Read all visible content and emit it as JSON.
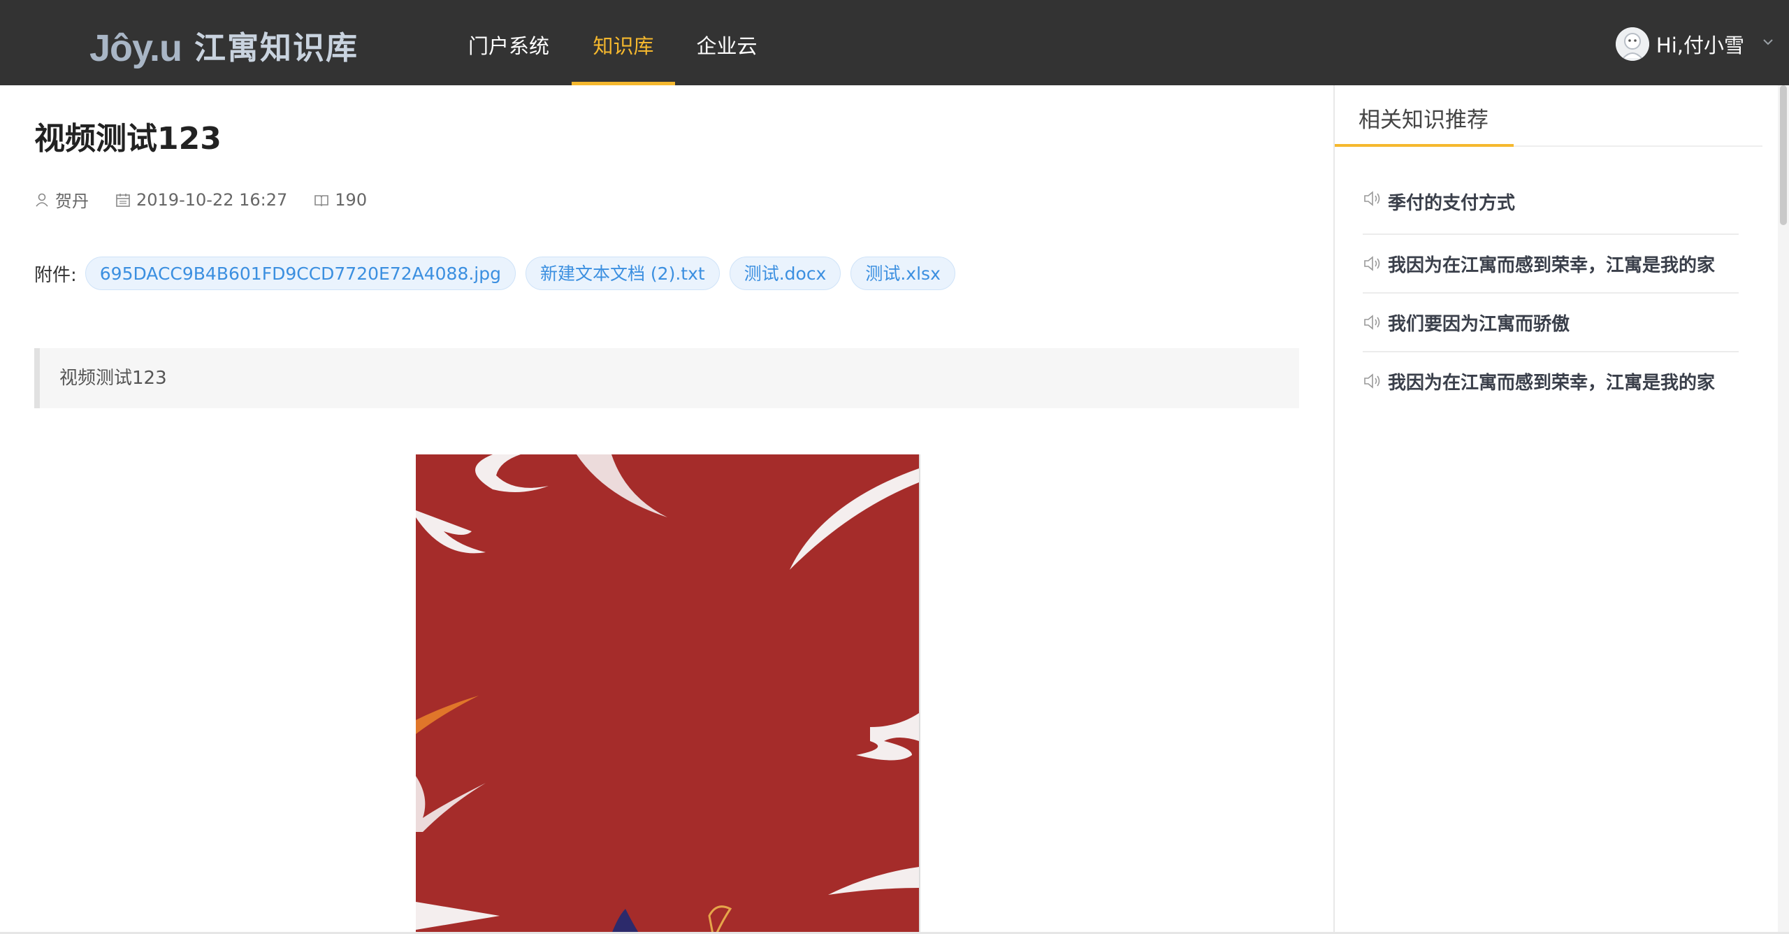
{
  "header": {
    "logo_text": "Jôy.u",
    "site_title": "江寓知识库",
    "nav": [
      {
        "label": "门户系统",
        "active": false
      },
      {
        "label": "知识库",
        "active": true
      },
      {
        "label": "企业云",
        "active": false
      }
    ],
    "user_greeting": "Hi,付小雪"
  },
  "article": {
    "title": "视频测试123",
    "author": "贺丹",
    "date": "2019-10-22 16:27",
    "views": "190",
    "attachments_label": "附件:",
    "attachments": [
      "695DACC9B4B601FD9CCD7720E72A4088.jpg",
      "新建文本文档 (2).txt",
      "测试.docx",
      "测试.xlsx"
    ],
    "summary": "视频测试123"
  },
  "sidebar": {
    "title": "相关知识推荐",
    "items": [
      "季付的支付方式",
      "我因为在江寓而感到荣幸，江寓是我的家",
      "我们要因为江寓而骄傲",
      "我因为在江寓而感到荣幸，江寓是我的家"
    ]
  },
  "colors": {
    "topbar": "#333333",
    "accent": "#f5b82e",
    "chip_text": "#3b8fe0",
    "media_bg": "#a52c2a"
  },
  "icons": [
    "user-icon",
    "calendar-icon",
    "book-icon",
    "speaker-icon",
    "chevron-down-icon"
  ]
}
